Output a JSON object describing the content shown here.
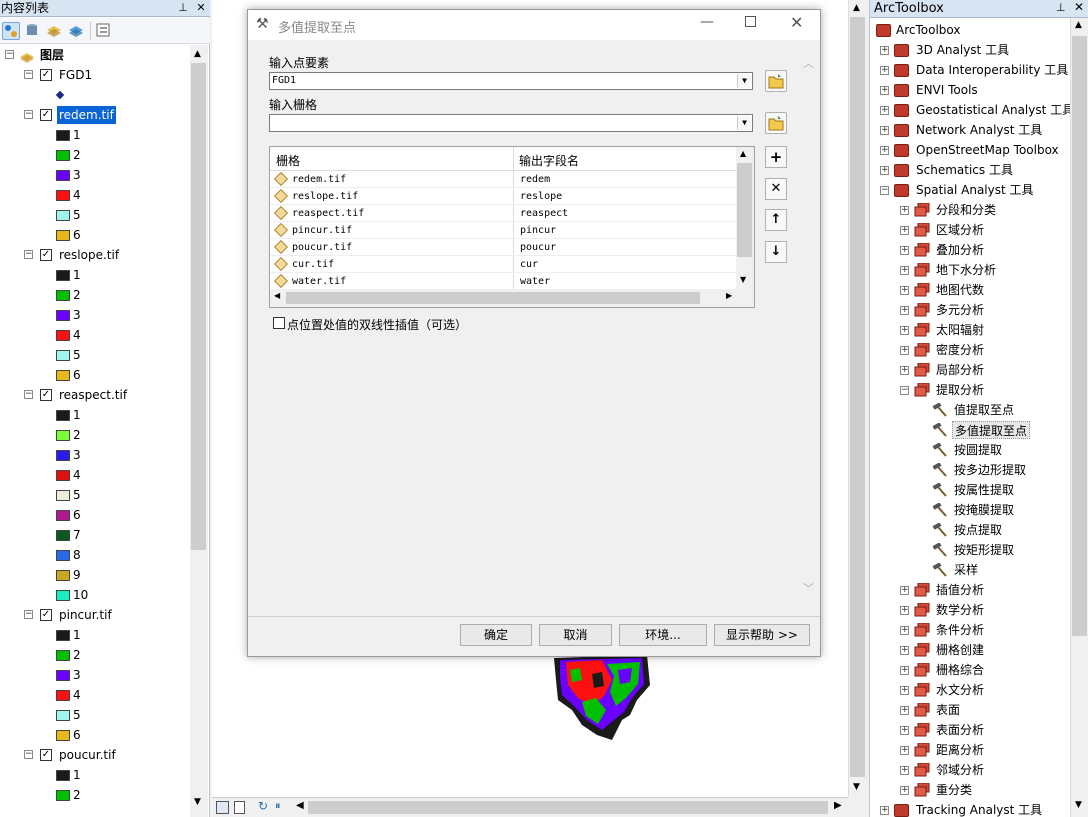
{
  "toc": {
    "title": "内容列表",
    "root_label": "图层",
    "layers": [
      {
        "name": "FGD1",
        "checked": true,
        "point_symbol": true,
        "classes": []
      },
      {
        "name": "redem.tif",
        "checked": true,
        "selected": true,
        "classes": [
          {
            "label": "1",
            "color": "#1a1a1a"
          },
          {
            "label": "2",
            "color": "#00c000"
          },
          {
            "label": "3",
            "color": "#6a00ff"
          },
          {
            "label": "4",
            "color": "#ff1010"
          },
          {
            "label": "5",
            "color": "#9ff5ea"
          },
          {
            "label": "6",
            "color": "#e8b81a"
          }
        ]
      },
      {
        "name": "reslope.tif",
        "checked": true,
        "classes": [
          {
            "label": "1",
            "color": "#1a1a1a"
          },
          {
            "label": "2",
            "color": "#00c000"
          },
          {
            "label": "3",
            "color": "#6a00ff"
          },
          {
            "label": "4",
            "color": "#ff1010"
          },
          {
            "label": "5",
            "color": "#9ff5ea"
          },
          {
            "label": "6",
            "color": "#e8b81a"
          }
        ]
      },
      {
        "name": "reaspect.tif",
        "checked": true,
        "classes": [
          {
            "label": "1",
            "color": "#1a1a1a"
          },
          {
            "label": "2",
            "color": "#7cff3a"
          },
          {
            "label": "3",
            "color": "#2a1aee"
          },
          {
            "label": "4",
            "color": "#e01010"
          },
          {
            "label": "5",
            "color": "#f0ead8"
          },
          {
            "label": "6",
            "color": "#b01890"
          },
          {
            "label": "7",
            "color": "#0a5a20"
          },
          {
            "label": "8",
            "color": "#2a6ae8"
          },
          {
            "label": "9",
            "color": "#c8a820"
          },
          {
            "label": "10",
            "color": "#1aeec0"
          }
        ]
      },
      {
        "name": "pincur.tif",
        "checked": true,
        "classes": [
          {
            "label": "1",
            "color": "#1a1a1a"
          },
          {
            "label": "2",
            "color": "#00c000"
          },
          {
            "label": "3",
            "color": "#6a00ff"
          },
          {
            "label": "4",
            "color": "#ff1010"
          },
          {
            "label": "5",
            "color": "#9ff5ea"
          },
          {
            "label": "6",
            "color": "#e8b81a"
          }
        ]
      },
      {
        "name": "poucur.tif",
        "checked": true,
        "classes": [
          {
            "label": "1",
            "color": "#1a1a1a"
          },
          {
            "label": "2",
            "color": "#00c000"
          }
        ]
      }
    ]
  },
  "dialog": {
    "title": "多值提取至点",
    "input_points_label": "输入点要素",
    "input_points_value": "FGD1",
    "input_raster_label": "输入栅格",
    "input_raster_value": "",
    "grid_header_raster": "栅格",
    "grid_header_field": "输出字段名",
    "rows": [
      {
        "raster": "redem.tif",
        "field": "redem"
      },
      {
        "raster": "reslope.tif",
        "field": "reslope"
      },
      {
        "raster": "reaspect.tif",
        "field": "reaspect"
      },
      {
        "raster": "pincur.tif",
        "field": "pincur"
      },
      {
        "raster": "poucur.tif",
        "field": "poucur"
      },
      {
        "raster": "cur.tif",
        "field": "cur"
      },
      {
        "raster": "water.tif",
        "field": "water"
      }
    ],
    "bilinear_label": "点位置处值的双线性插值（可选）",
    "bilinear_checked": false,
    "ok": "确定",
    "cancel": "取消",
    "env": "环境...",
    "help": "显示帮助 >>"
  },
  "arctoolbox": {
    "title": "ArcToolbox",
    "root": "ArcToolbox",
    "toolboxes": [
      "3D Analyst 工具",
      "Data Interoperability 工具",
      "ENVI Tools",
      "Geostatistical Analyst 工具",
      "Network Analyst 工具",
      "OpenStreetMap Toolbox",
      "Schematics 工具",
      "Spatial Analyst 工具"
    ],
    "spatial_sets_before": [
      "分段和分类",
      "区域分析",
      "叠加分析",
      "地下水分析",
      "地图代数",
      "多元分析",
      "太阳辐射",
      "密度分析",
      "局部分析",
      "提取分析"
    ],
    "extract_tools": [
      "值提取至点",
      "多值提取至点",
      "按圆提取",
      "按多边形提取",
      "按属性提取",
      "按掩膜提取",
      "按点提取",
      "按矩形提取",
      "采样"
    ],
    "selected_tool": "多值提取至点",
    "spatial_sets_after": [
      "插值分析",
      "数学分析",
      "条件分析",
      "栅格创建",
      "栅格综合",
      "水文分析",
      "表面",
      "表面分析",
      "距离分析",
      "邻域分析",
      "重分类"
    ],
    "last_toolbox": "Tracking Analyst 工具"
  }
}
